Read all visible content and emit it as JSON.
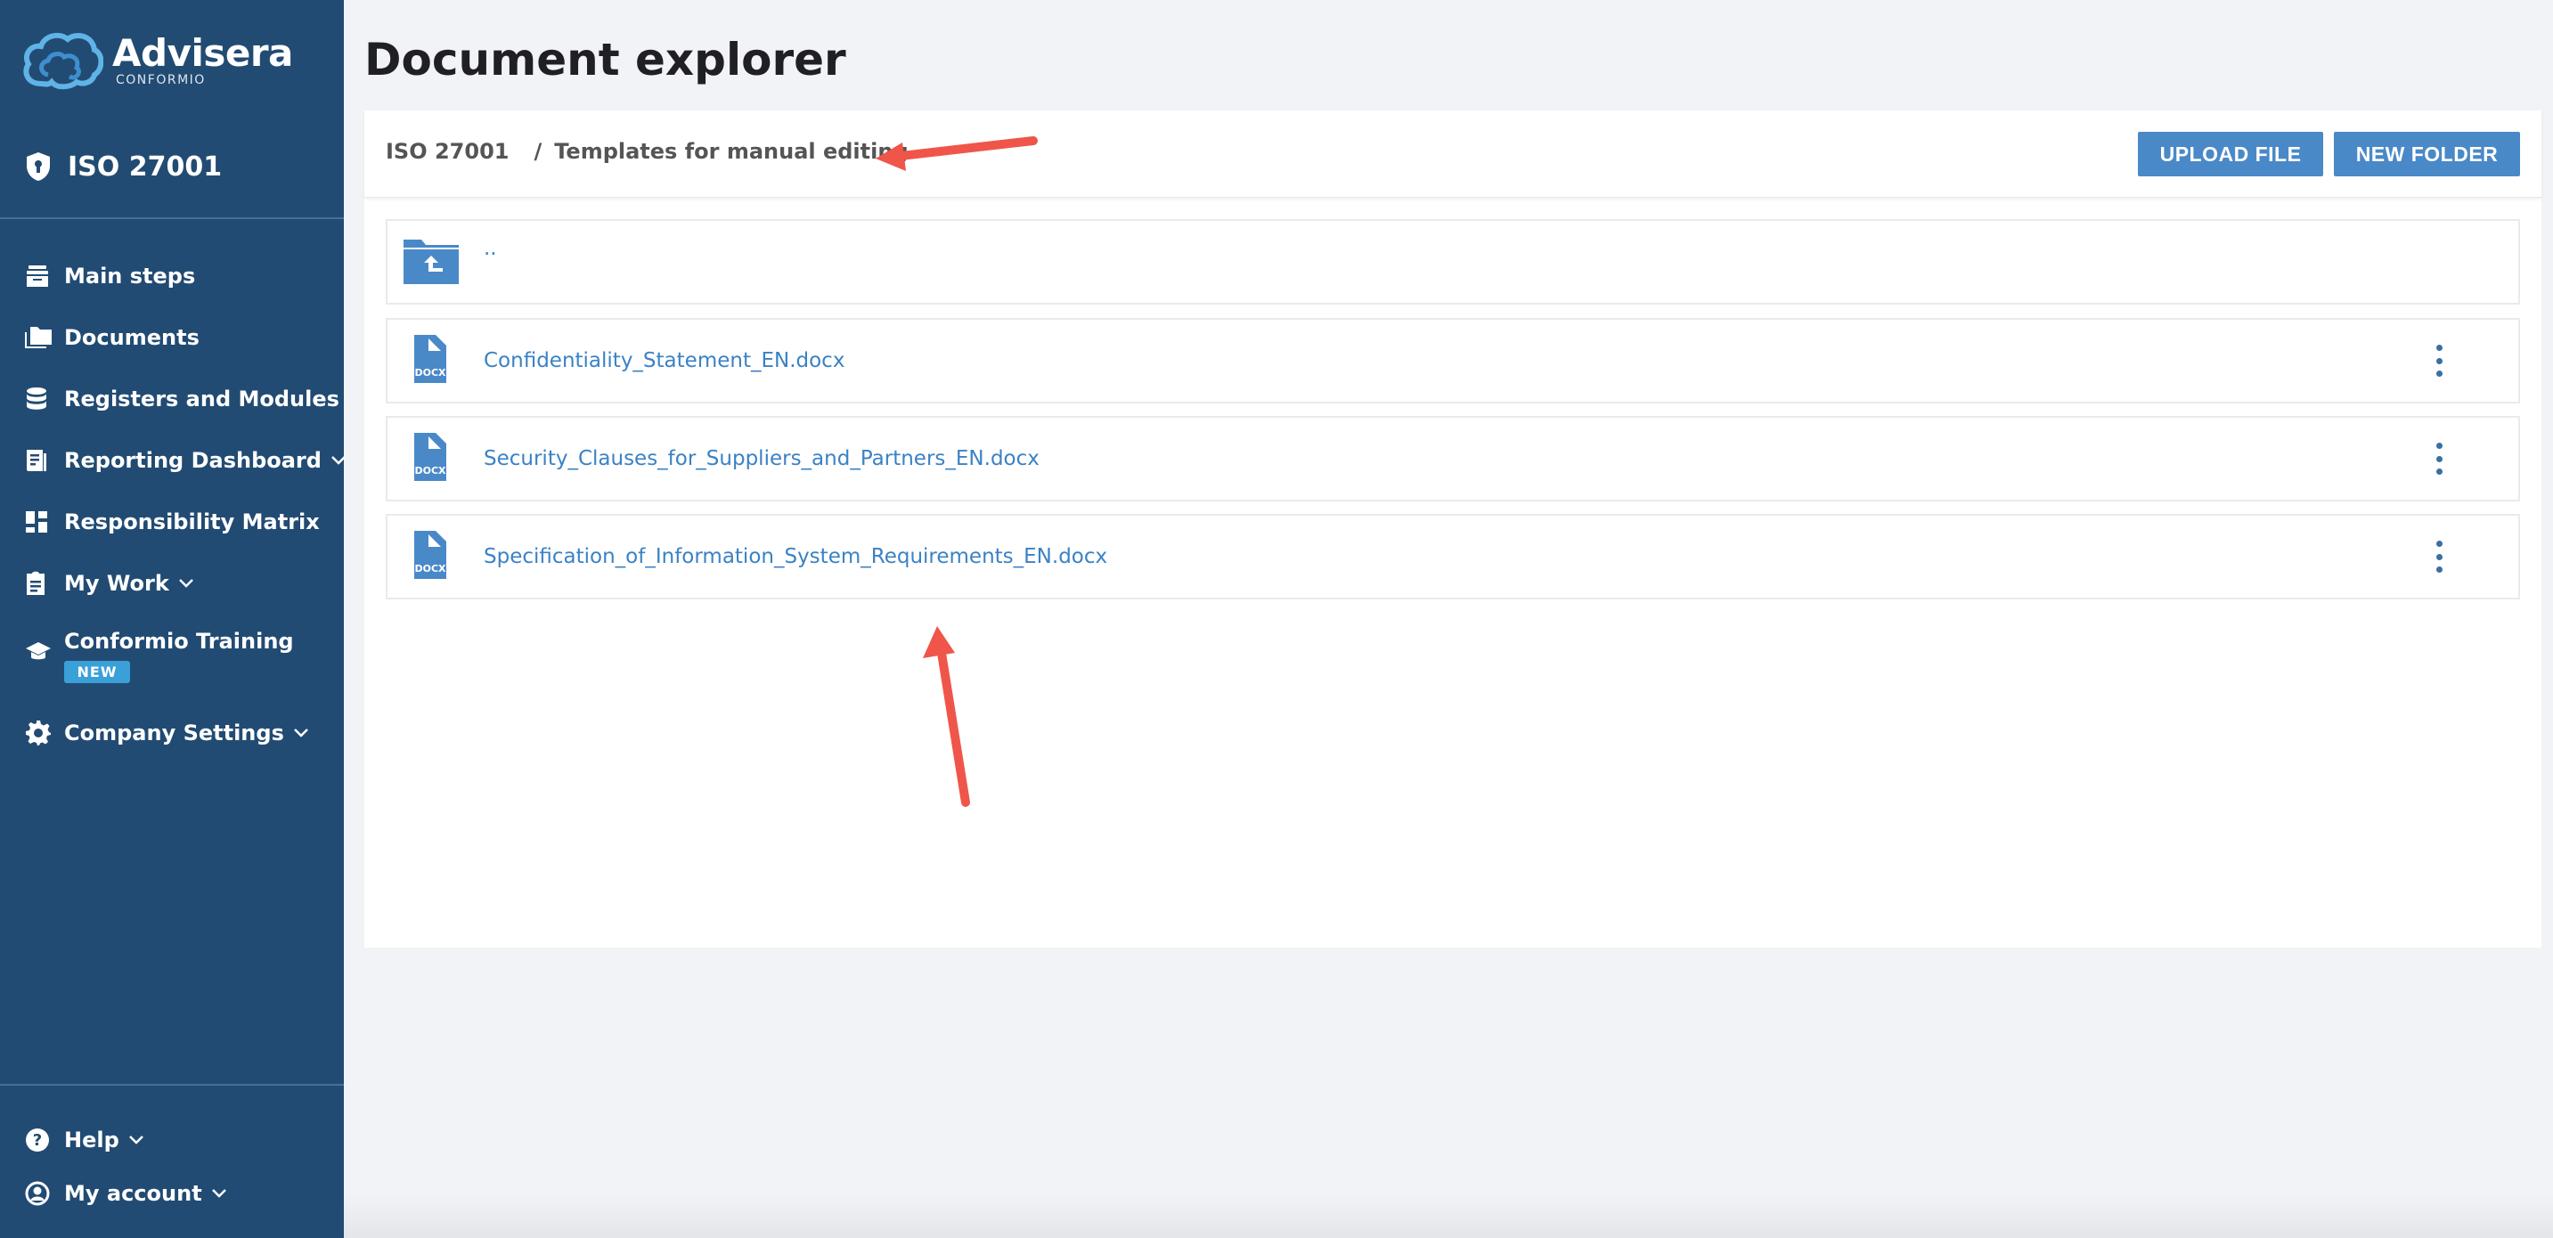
{
  "brand": {
    "name": "Advisera",
    "sub": "CONFORMIO"
  },
  "standard": {
    "label": "ISO 27001"
  },
  "nav": [
    {
      "label": "Main steps",
      "icon": "inbox-icon",
      "dropdown": false
    },
    {
      "label": "Documents",
      "icon": "folders-icon",
      "dropdown": false
    },
    {
      "label": "Registers and Modules",
      "icon": "database-icon",
      "dropdown": false
    },
    {
      "label": "Reporting Dashboard",
      "icon": "report-icon",
      "dropdown": true
    },
    {
      "label": "Responsibility Matrix",
      "icon": "dashboard-grid-icon",
      "dropdown": false
    },
    {
      "label": "My Work",
      "icon": "clipboard-icon",
      "dropdown": true
    },
    {
      "label": "Conformio Training",
      "icon": "graduation-cap-icon",
      "dropdown": false,
      "badge": "NEW"
    },
    {
      "label": "Company Settings",
      "icon": "gear-icon",
      "dropdown": true
    }
  ],
  "footer_nav": [
    {
      "label": "Help",
      "icon": "help-circle-icon",
      "dropdown": true
    },
    {
      "label": "My account",
      "icon": "user-circle-icon",
      "dropdown": true
    }
  ],
  "page": {
    "title": "Document explorer"
  },
  "breadcrumb": {
    "root": "ISO 27001",
    "separator": "/",
    "current": "Templates for manual editing"
  },
  "actions": {
    "upload": "UPLOAD FILE",
    "new_folder": "NEW FOLDER"
  },
  "files": {
    "parent": {
      "label": ".."
    },
    "items": [
      {
        "name": "Confidentiality_Statement_EN.docx",
        "type": "DOCX"
      },
      {
        "name": "Security_Clauses_for_Suppliers_and_Partners_EN.docx",
        "type": "DOCX"
      },
      {
        "name": "Specification_of_Information_System_Requirements_EN.docx",
        "type": "DOCX"
      }
    ]
  },
  "colors": {
    "sidebar": "#224b73",
    "accent": "#4a89c8",
    "link": "#3b82c4",
    "badge": "#3aa0d8",
    "annotation_arrow": "#f0554a"
  }
}
